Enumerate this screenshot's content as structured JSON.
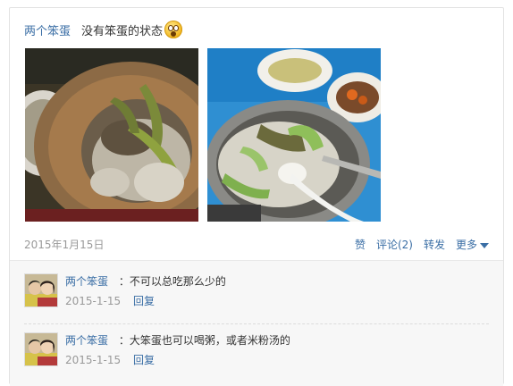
{
  "post": {
    "author": "两个笨蛋",
    "status": "没有笨蛋的状态",
    "emoji_icon": "surprised-face-icon",
    "date": "2015年1月15日",
    "actions": {
      "like": "赞",
      "comment": "评论(2)",
      "share": "转发",
      "more": "更多"
    }
  },
  "comments": [
    {
      "author": "两个笨蛋",
      "separator": "：",
      "text": "不可以总吃那么少的",
      "date": "2015-1-15",
      "reply": "回复"
    },
    {
      "author": "两个笨蛋",
      "separator": "：",
      "text": "大笨蛋也可以喝粥，或者米粉汤的",
      "date": "2015-1-15",
      "reply": "回复"
    }
  ],
  "colors": {
    "link": "#3a6ea5",
    "muted": "#999999",
    "comment_bg": "#f7f7f7"
  }
}
